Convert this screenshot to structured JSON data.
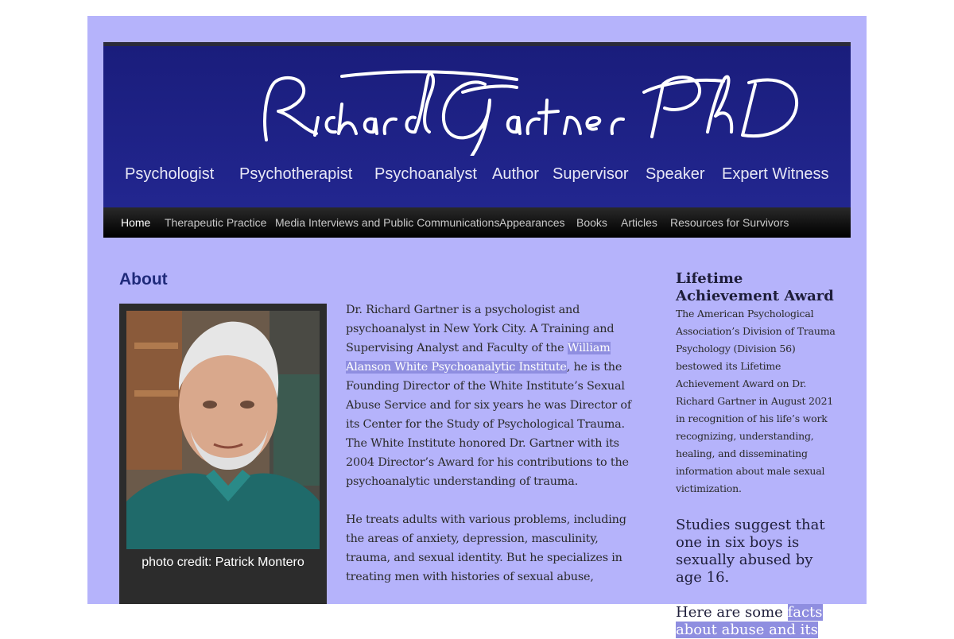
{
  "header": {
    "logo_text": "Richard Gartner PhD",
    "tagline": [
      "Psychologist",
      "Psychotherapist",
      "Psychoanalyst",
      "Author",
      "Supervisor",
      "Speaker",
      "Expert Witness"
    ]
  },
  "nav": {
    "items": [
      {
        "label": "Home",
        "active": true
      },
      {
        "label": "Therapeutic Practice"
      },
      {
        "label": "Media Interviews and Public Communications"
      },
      {
        "label": "Appearances"
      },
      {
        "label": "Books"
      },
      {
        "label": "Articles"
      },
      {
        "label": "Resources for Survivors"
      }
    ]
  },
  "main": {
    "title": "About",
    "photo_caption": "photo credit: Patrick Montero",
    "para1_a": "Dr. Richard Gartner is a psychologist and psychoanalyst in New York City. A Training and Supervising Analyst and Faculty of the ",
    "para1_link": "William Alanson White Psychoanalytic Institute",
    "para1_b": ", he is the Founding Director of the White Institute’s Sexual Abuse Service and for six years he was Director of its Center for the Study of Psychological Trauma. The White Institute honored Dr. Gartner with its 2004 Director’s Award for his contributions to the psychoanalytic understanding of trauma.",
    "para2": "He treats adults with various problems, including the areas of anxiety, depression, masculinity, trauma, and sexual identity.  But he specializes in treating men with histories of sexual abuse,"
  },
  "sidebar": {
    "award_title": "Lifetime Achievement Award",
    "award_text": "The American Psychological Association’s Division of Trauma Psychology (Division 56) bestowed its Lifetime Achievement Award on Dr. Richard Gartner in August 2021 in recognition of his life’s work recognizing, understanding, healing, and disseminating information about male sexual victimization.",
    "studies_text": "Studies suggest that one in six boys is sexually abused by age 16.",
    "facts_prefix": "Here are some ",
    "facts_link": "facts about abuse and its"
  },
  "colors": {
    "page_bg": "#b5b3fb",
    "banner_bg": "#1a1d7c",
    "nav_bg": "#000000",
    "link_highlight": "#8f8ee0",
    "title_color": "#1f2a7a"
  }
}
